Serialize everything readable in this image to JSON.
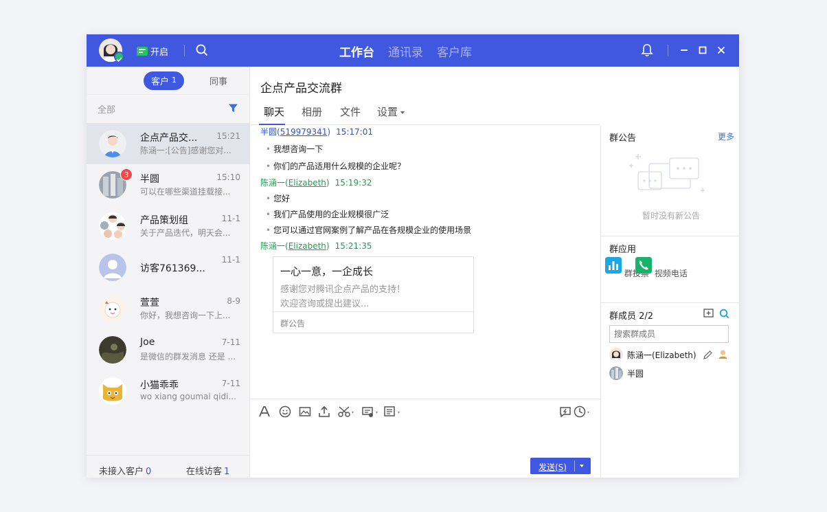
{
  "topbar": {
    "status_label": "开启",
    "nav": [
      "工作台",
      "通讯录",
      "客户库"
    ],
    "active_nav": "工作台",
    "icons": [
      "search-icon",
      "bell-icon",
      "minimize-icon",
      "maximize-icon",
      "close-icon"
    ]
  },
  "left": {
    "seg_active_label": "客户",
    "seg_active_count": "1",
    "seg_inactive_label": "同事",
    "filter_label": "全部",
    "conversations": [
      {
        "name": "企点产品交...",
        "time": "15:21",
        "preview": "陈涵一:[公告]感谢您对...",
        "badge": ""
      },
      {
        "name": "半圆",
        "time": "15:10",
        "preview": "可以在哪些渠道挂载接...",
        "badge": "3"
      },
      {
        "name": "产品策划组",
        "time": "11-1",
        "preview": "关于产品迭代，明天会...",
        "badge": ""
      },
      {
        "name": "访客761369...",
        "time": "11-1",
        "preview": "",
        "badge": ""
      },
      {
        "name": "萱萱",
        "time": "8-9",
        "preview": "你好，我想咨询一下上...",
        "badge": ""
      },
      {
        "name": "Joe",
        "time": "7-11",
        "preview": "是微信的群发消息 还是 ...",
        "badge": ""
      },
      {
        "name": "小猫乖乖",
        "time": "7-11",
        "preview": "wo xiang goumai qidi...",
        "badge": ""
      }
    ],
    "footer": {
      "unconnected_label": "未接入客户",
      "unconnected_count": "0",
      "online_label": "在线访客",
      "online_count": "1"
    }
  },
  "chat": {
    "title": "企点产品交流群",
    "tabs": [
      "聊天",
      "相册",
      "文件",
      "设置"
    ],
    "messages": [
      {
        "name": "半圆(",
        "id": "519979341",
        "close": ")",
        "time": "15:17:01",
        "lines": [
          "我想咨询一下",
          "你们的产品适用什么规模的企业呢？"
        ]
      },
      {
        "name": "陈涵一(",
        "id": "Elizabeth",
        "close": ")",
        "time": "15:19:32",
        "lines": [
          "您好",
          "我们产品使用的企业规模很广泛",
          "您可以通过官网案例了解产品在各规模企业的使用场景"
        ]
      },
      {
        "name": "陈涵一(",
        "id": "Elizabeth",
        "close": ")",
        "time": "15:21:35",
        "lines": []
      }
    ],
    "notice_card": {
      "title": "一心一意，一企成长",
      "line1": "感谢您对腾讯企点产品的支持！",
      "line2": "欢迎咨询或提出建议...",
      "footer": "群公告"
    },
    "send_label": "发送(S)"
  },
  "right": {
    "announcement_title": "群公告",
    "more_label": "更多",
    "empty_text": "暂时没有新公告",
    "apps_title": "群应用",
    "apps": [
      {
        "label": "群投票",
        "color": "#1aa7e6"
      },
      {
        "label": "视频电话",
        "color": "#17b36b"
      }
    ],
    "members_title": "群成员",
    "members_count": "2/2",
    "member_search_placeholder": "搜索群成员",
    "members": [
      {
        "name": "陈涵一(Elizabeth)"
      },
      {
        "name": "半圆"
      }
    ]
  },
  "colors": {
    "accent": "#4057e0",
    "green": "#20a050",
    "badge": "#f04848"
  }
}
